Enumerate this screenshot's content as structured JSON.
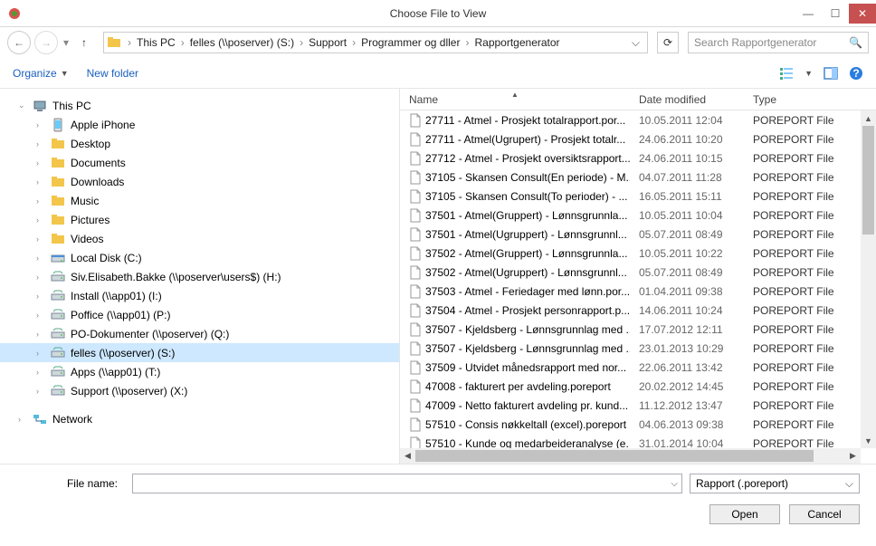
{
  "window": {
    "title": "Choose File to View"
  },
  "nav": {
    "breadcrumbs": [
      "This PC",
      "felles (\\\\poserver) (S:)",
      "Support",
      "Programmer og dller",
      "Rapportgenerator"
    ],
    "search_placeholder": "Search Rapportgenerator"
  },
  "toolbar": {
    "organize": "Organize",
    "newfolder": "New folder"
  },
  "tree": {
    "root": "This PC",
    "items": [
      {
        "label": "Apple iPhone",
        "icon": "phone"
      },
      {
        "label": "Desktop",
        "icon": "folder"
      },
      {
        "label": "Documents",
        "icon": "folder"
      },
      {
        "label": "Downloads",
        "icon": "folder"
      },
      {
        "label": "Music",
        "icon": "folder"
      },
      {
        "label": "Pictures",
        "icon": "folder"
      },
      {
        "label": "Videos",
        "icon": "folder"
      },
      {
        "label": "Local Disk (C:)",
        "icon": "disk"
      },
      {
        "label": "Siv.Elisabeth.Bakke (\\\\poserver\\users$) (H:)",
        "icon": "netdrive"
      },
      {
        "label": "Install (\\\\app01) (I:)",
        "icon": "netdrive"
      },
      {
        "label": "Poffice (\\\\app01) (P:)",
        "icon": "netdrive"
      },
      {
        "label": "PO-Dokumenter (\\\\poserver) (Q:)",
        "icon": "netdrive"
      },
      {
        "label": "felles (\\\\poserver) (S:)",
        "icon": "netdrive",
        "selected": true
      },
      {
        "label": "Apps (\\\\app01) (T:)",
        "icon": "netdrive"
      },
      {
        "label": "Support (\\\\poserver) (X:)",
        "icon": "netdrive"
      }
    ],
    "network": "Network"
  },
  "columns": {
    "name": "Name",
    "date": "Date modified",
    "type": "Type"
  },
  "files": [
    {
      "name": "27711 - Atmel - Prosjekt totalrapport.por...",
      "date": "10.05.2011 12:04",
      "type": "POREPORT File"
    },
    {
      "name": "27711 - Atmel(Ugrupert) - Prosjekt totalr...",
      "date": "24.06.2011 10:20",
      "type": "POREPORT File"
    },
    {
      "name": "27712 - Atmel - Prosjekt oversiktsrapport...",
      "date": "24.06.2011 10:15",
      "type": "POREPORT File"
    },
    {
      "name": "37105 - Skansen Consult(En periode) - M...",
      "date": "04.07.2011 11:28",
      "type": "POREPORT File"
    },
    {
      "name": "37105 - Skansen Consult(To perioder) - ...",
      "date": "16.05.2011 15:11",
      "type": "POREPORT File"
    },
    {
      "name": "37501 - Atmel(Gruppert) - Lønnsgrunnla...",
      "date": "10.05.2011 10:04",
      "type": "POREPORT File"
    },
    {
      "name": "37501 - Atmel(Ugruppert) - Lønnsgrunnl...",
      "date": "05.07.2011 08:49",
      "type": "POREPORT File"
    },
    {
      "name": "37502 - Atmel(Gruppert) - Lønnsgrunnla...",
      "date": "10.05.2011 10:22",
      "type": "POREPORT File"
    },
    {
      "name": "37502 - Atmel(Ugruppert) - Lønnsgrunnl...",
      "date": "05.07.2011 08:49",
      "type": "POREPORT File"
    },
    {
      "name": "37503 - Atmel - Feriedager med lønn.por...",
      "date": "01.04.2011 09:38",
      "type": "POREPORT File"
    },
    {
      "name": "37504 - Atmel - Prosjekt personrapport.p...",
      "date": "14.06.2011 10:24",
      "type": "POREPORT File"
    },
    {
      "name": "37507 - Kjeldsberg - Lønnsgrunnlag med ...",
      "date": "17.07.2012 12:11",
      "type": "POREPORT File"
    },
    {
      "name": "37507 - Kjeldsberg - Lønnsgrunnlag med ...",
      "date": "23.01.2013 10:29",
      "type": "POREPORT File"
    },
    {
      "name": "37509 - Utvidet månedsrapport med nor...",
      "date": "22.06.2011 13:42",
      "type": "POREPORT File"
    },
    {
      "name": "47008 - fakturert per avdeling.poreport",
      "date": "20.02.2012 14:45",
      "type": "POREPORT File"
    },
    {
      "name": "47009 - Netto fakturert avdeling pr. kund...",
      "date": "11.12.2012 13:47",
      "type": "POREPORT File"
    },
    {
      "name": "57510 - Consis nøkkeltall (excel).poreport",
      "date": "04.06.2013 09:38",
      "type": "POREPORT File"
    },
    {
      "name": "57510 - Kunde og medarbeideranalyse (e...",
      "date": "31.01.2014 10:04",
      "type": "POREPORT File"
    }
  ],
  "bottom": {
    "filename_label": "File name:",
    "filter": "Rapport (.poreport)",
    "open": "Open",
    "cancel": "Cancel"
  }
}
